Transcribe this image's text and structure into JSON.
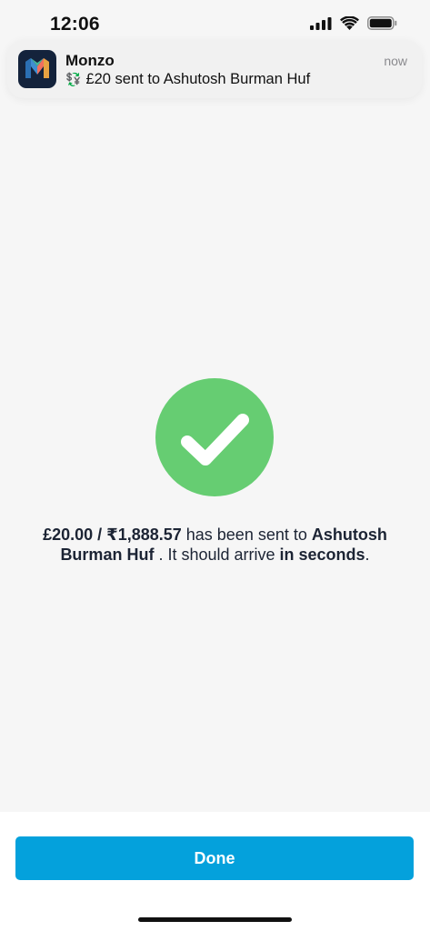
{
  "status_bar": {
    "time": "12:06",
    "icons": [
      "signal-icon",
      "wifi-icon",
      "battery-icon"
    ]
  },
  "notification": {
    "app_name": "Monzo",
    "time": "now",
    "emoji": "💱",
    "message": "£20 sent to Ashutosh Burman Huf",
    "icon": "monzo-logo-icon"
  },
  "success": {
    "icon": "checkmark-icon",
    "color": "#66cd72"
  },
  "message": {
    "amount": "£20.00 / ₹1,888.57",
    "text_1": " has been sent to ",
    "recipient": "Ashutosh Burman Huf",
    "text_2": " . It should arrive ",
    "arrival": "in seconds",
    "text_3": "."
  },
  "actions": {
    "done_label": "Done",
    "done_color": "#04a1dc"
  }
}
